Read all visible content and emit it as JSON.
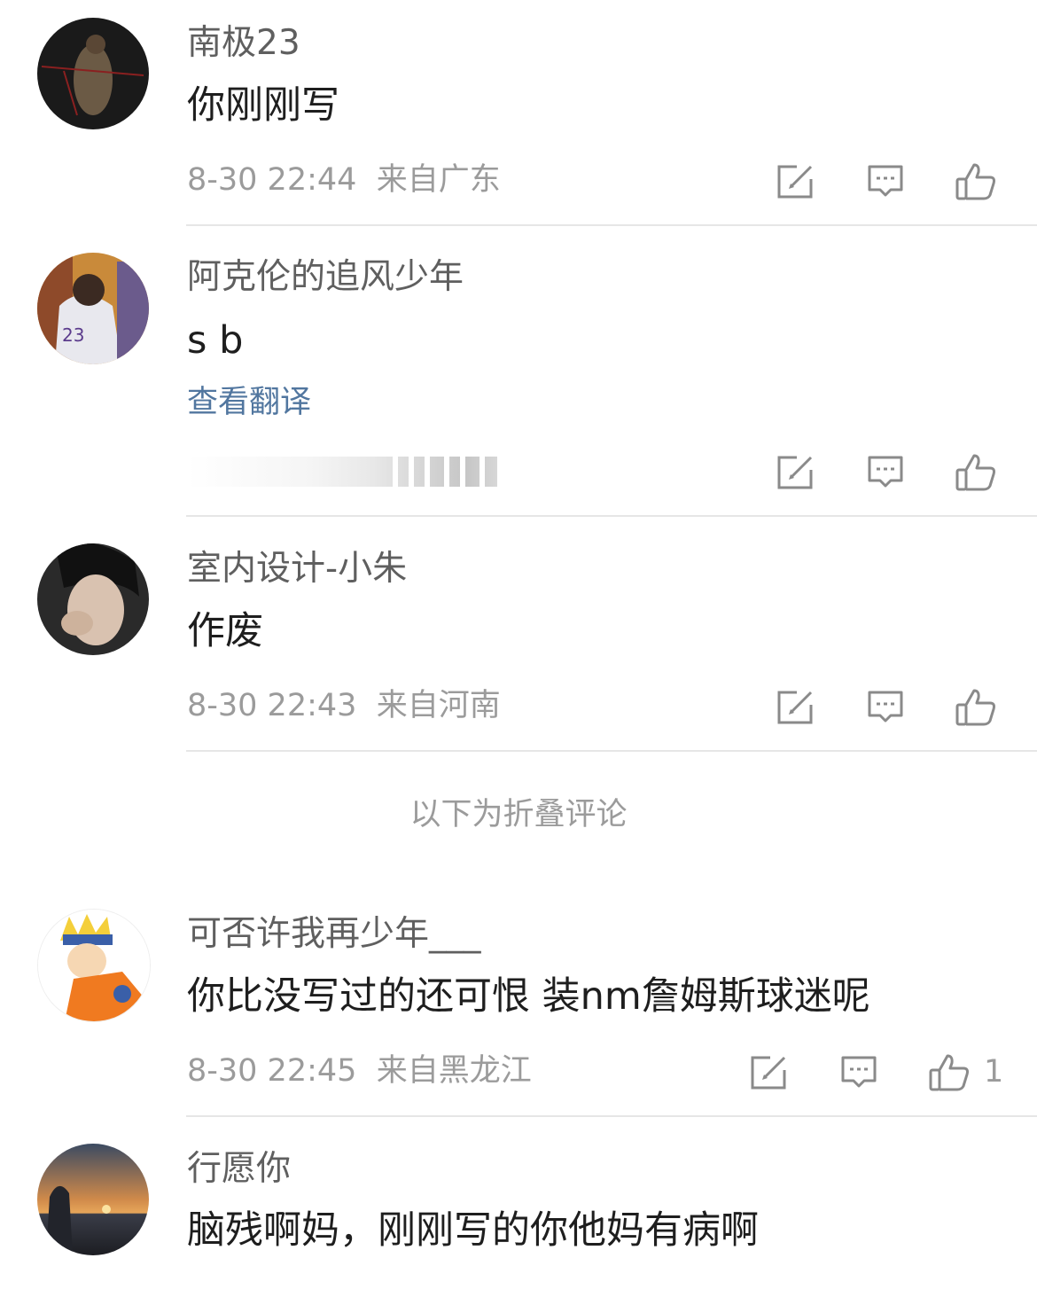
{
  "comments": [
    {
      "name": "南极23",
      "text": "你刚刚写",
      "time": "8-30 22:44",
      "location": "来自广东"
    },
    {
      "name": "阿克伦的追风少年",
      "text": "s b",
      "translate": "查看翻译"
    },
    {
      "name": "室内设计-小朱",
      "text": "作废",
      "time": "8-30 22:43",
      "location": "来自河南"
    },
    {
      "name": "可否许我再少年___",
      "text": "你比没写过的还可恨 装nm詹姆斯球迷呢",
      "time": "8-30 22:45",
      "location": "来自黑龙江",
      "likes": "1"
    },
    {
      "name": "行愿你",
      "text": "脑残啊妈，刚刚写的你他妈有病啊"
    }
  ],
  "folded_label": "以下为折叠评论",
  "icons": [
    "edit-icon",
    "reply-icon",
    "like-icon"
  ],
  "colors": {
    "link": "#51769f",
    "meta": "#9b9b9b",
    "name": "#5f5f5f",
    "text": "#1e1e1e"
  }
}
